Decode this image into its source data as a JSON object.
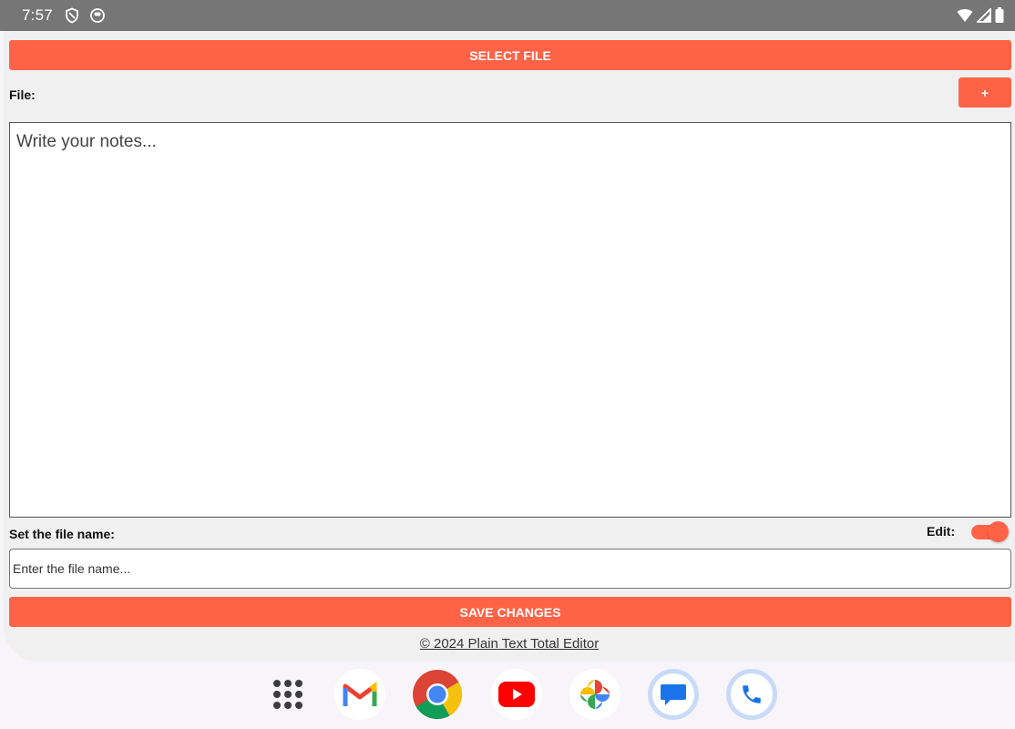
{
  "status_bar": {
    "time": "7:57"
  },
  "app": {
    "select_file_label": "SELECT FILE",
    "file_label": "File:",
    "add_label": "+",
    "notes_placeholder": "Write your notes...",
    "filename_label": "Set the file name:",
    "edit_label": "Edit:",
    "edit_toggle_on": true,
    "filename_placeholder": "Enter the file name...",
    "save_label": "SAVE CHANGES",
    "footer": "© 2024 Plain Text Total Editor",
    "accent_color": "#ff6347"
  },
  "dock": {
    "apps": [
      "app-drawer",
      "gmail",
      "chrome",
      "youtube",
      "photos",
      "messages",
      "phone"
    ]
  }
}
